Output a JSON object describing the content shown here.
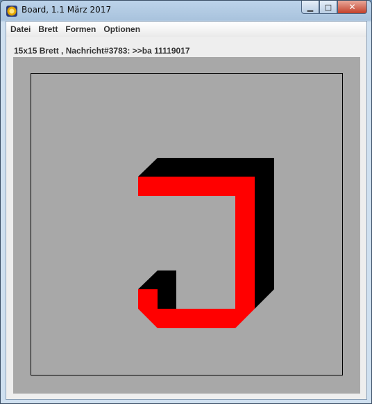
{
  "window": {
    "title": "Board, 1.1 März 2017"
  },
  "window_controls": {
    "minimize": "▁",
    "maximize": "□",
    "close": "✕"
  },
  "menu": [
    {
      "label": "Datei"
    },
    {
      "label": "Brett"
    },
    {
      "label": "Formen"
    },
    {
      "label": "Optionen"
    }
  ],
  "status": {
    "text": "15x15 Brett , Nachricht#3783: >>ba 11119017"
  },
  "board": {
    "size": "15x15",
    "background": "#a8a8a8",
    "shape": {
      "type": "letter-J",
      "front_color": "#ff0000",
      "shadow_color": "#000000"
    }
  }
}
